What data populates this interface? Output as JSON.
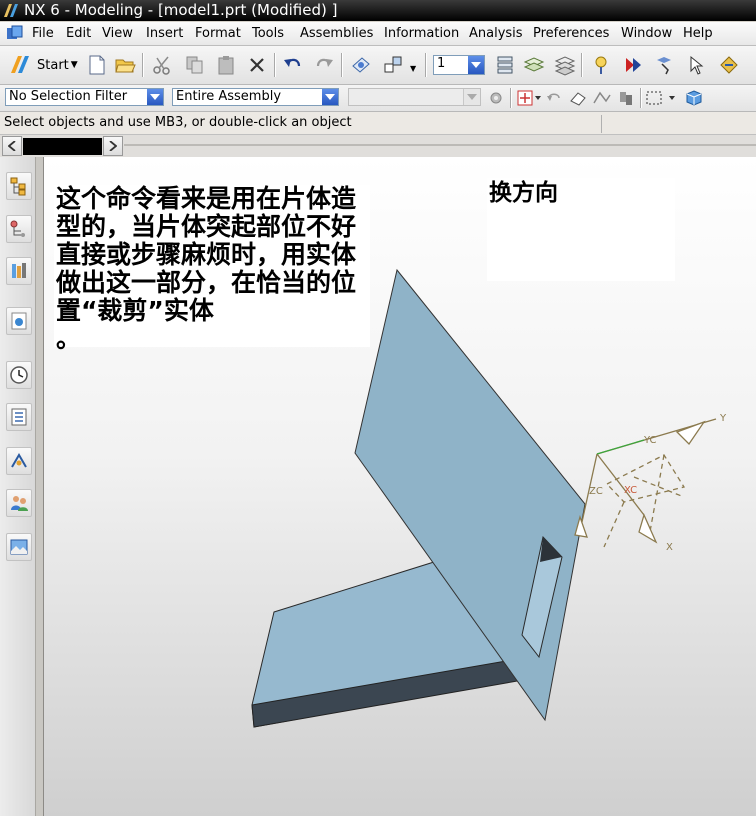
{
  "window": {
    "title": "NX 6 - Modeling - [model1.prt (Modified) ]"
  },
  "menubar": {
    "items": [
      "File",
      "Edit",
      "View",
      "Insert",
      "Format",
      "Tools",
      "Assemblies",
      "Information",
      "Analysis",
      "Preferences",
      "Window",
      "Help"
    ]
  },
  "toolbar": {
    "start_label": "Start",
    "layer_value": "1"
  },
  "selection_bar": {
    "filter": "No Selection Filter",
    "scope": "Entire Assembly",
    "third": ""
  },
  "status": {
    "message": "Select objects and use MB3, or double-click an object"
  },
  "annotations": {
    "left_note": "这个命令看来是用在片体造型的，当片体突起部位不好直接或步骤麻烦时，用实体做出这一部分，在恰当的位置“裁剪”实体\n。",
    "right_note": "换方向"
  },
  "csys": {
    "x": "X",
    "y": "Y",
    "xc": "XC",
    "yc": "YC",
    "zc": "ZC"
  },
  "colors": {
    "titlebar": "#000000",
    "part_face": "#8fb3c8",
    "part_side": "#3a4650",
    "csys": "#8b7a4e"
  }
}
